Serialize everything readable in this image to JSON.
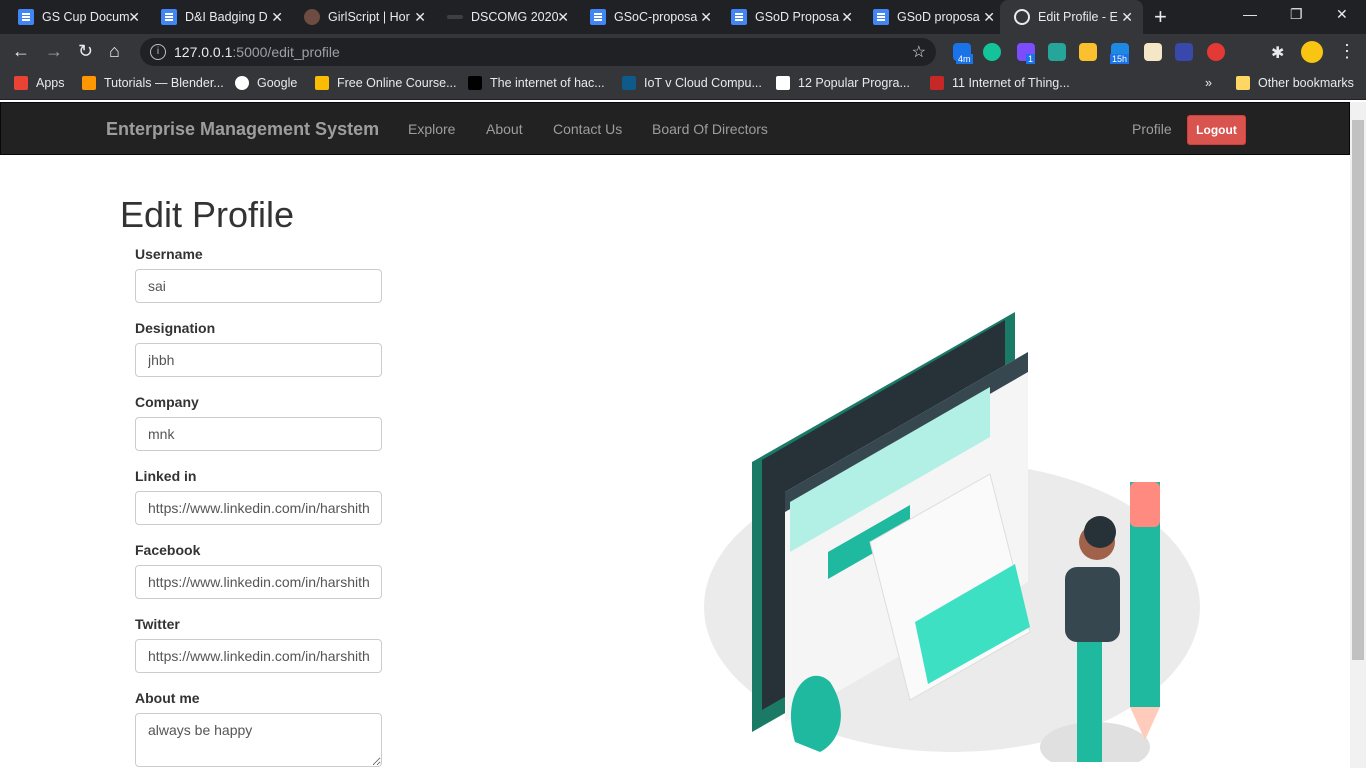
{
  "browser": {
    "tabs": [
      {
        "title": "GS Cup Docum",
        "favicon": "doc"
      },
      {
        "title": "D&I Badging D",
        "favicon": "doc"
      },
      {
        "title": "GirlScript | Hor",
        "favicon": "girlscript"
      },
      {
        "title": "DSCOMG 2020",
        "favicon": "dsc"
      },
      {
        "title": "GSoC-proposa",
        "favicon": "doc"
      },
      {
        "title": "GSoD Proposa",
        "favicon": "doc"
      },
      {
        "title": "GSoD proposa",
        "favicon": "doc"
      },
      {
        "title": "Edit Profile - E",
        "favicon": "globe",
        "active": true
      }
    ],
    "url_host": "127.0.0.1",
    "url_path": ":5000/edit_profile",
    "bookmarks": [
      {
        "label": "Apps"
      },
      {
        "label": "Tutorials — Blender..."
      },
      {
        "label": "Google"
      },
      {
        "label": "Free Online Course..."
      },
      {
        "label": "The internet of hac..."
      },
      {
        "label": "IoT v Cloud Compu..."
      },
      {
        "label": "12 Popular Progra..."
      },
      {
        "label": "11 Internet of Thing..."
      },
      {
        "label": "»"
      },
      {
        "label": "Other bookmarks"
      }
    ],
    "extension_badges": [
      "4m",
      "1",
      "15h"
    ]
  },
  "navbar": {
    "brand": "Enterprise Management System",
    "links": [
      "Explore",
      "About",
      "Contact Us",
      "Board Of Directors"
    ],
    "profile": "Profile",
    "logout": "Logout"
  },
  "form": {
    "heading": "Edit Profile",
    "fields": [
      {
        "label": "Username",
        "value": "sai"
      },
      {
        "label": "Designation",
        "value": "jhbh"
      },
      {
        "label": "Company",
        "value": "mnk"
      },
      {
        "label": "Linked in",
        "value": "https://www.linkedin.com/in/harshith"
      },
      {
        "label": "Facebook",
        "value": "https://www.linkedin.com/in/harshith"
      },
      {
        "label": "Twitter",
        "value": "https://www.linkedin.com/in/harshith"
      },
      {
        "label": "About me",
        "value": "always be happy"
      }
    ]
  },
  "colors": {
    "accent": "#1fb9a0",
    "logout": "#d9534f",
    "navbar": "#222222"
  }
}
